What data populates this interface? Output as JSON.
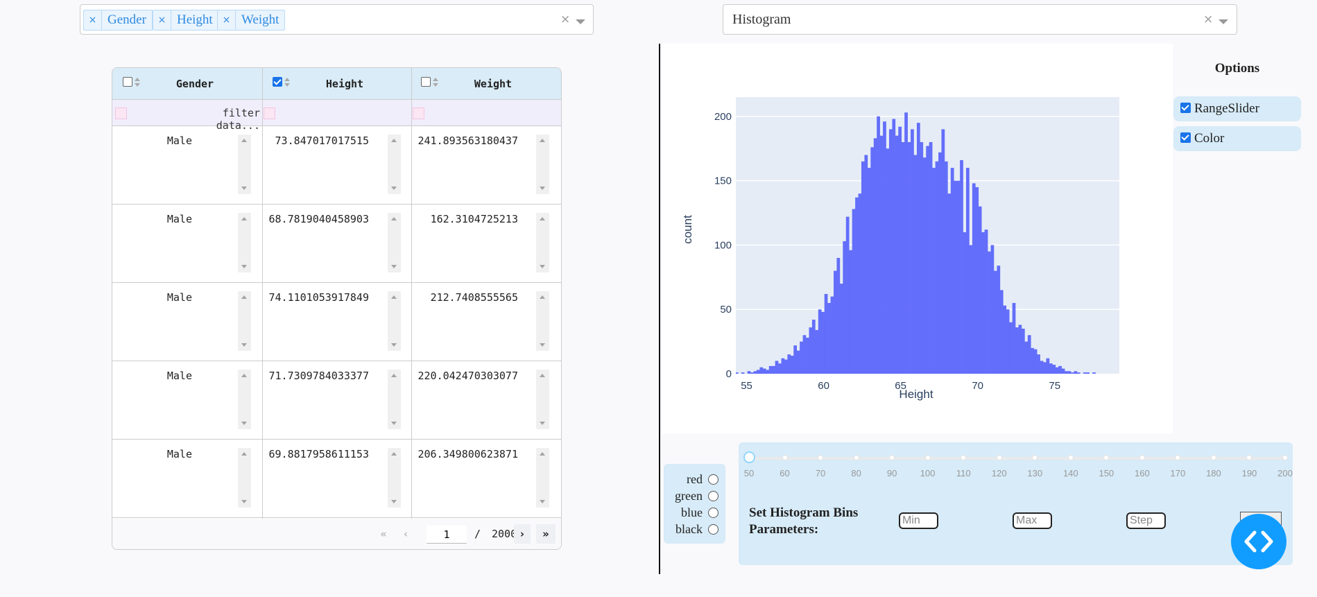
{
  "column_select": {
    "tags": [
      "Gender",
      "Height",
      "Weight"
    ],
    "clear_symbol": "×"
  },
  "chart_select": {
    "value": "Histogram",
    "clear_symbol": "×"
  },
  "table": {
    "columns": [
      {
        "label": "Gender",
        "selected": false
      },
      {
        "label": "Height",
        "selected": true
      },
      {
        "label": "Weight",
        "selected": false
      }
    ],
    "filter_placeholder": "filter data...",
    "rows": [
      [
        "Male",
        "73.847017017515",
        "241.893563180437"
      ],
      [
        "Male",
        "68.7819040458903",
        "162.3104725213"
      ],
      [
        "Male",
        "74.1101053917849",
        "212.7408555565"
      ],
      [
        "Male",
        "71.7309784033377",
        "220.042470303077"
      ],
      [
        "Male",
        "69.8817958611153",
        "206.349800623871"
      ]
    ],
    "pagination": {
      "current_page": "1",
      "separator": "/",
      "total_pages": "2000",
      "first_symbol": "«",
      "prev_symbol": "‹",
      "next_symbol": "›",
      "last_symbol": "»"
    }
  },
  "chart_data": {
    "type": "bar",
    "subtype": "histogram",
    "title": "",
    "xlabel": "Height",
    "ylabel": "count",
    "xlim": [
      54.3,
      79.2
    ],
    "ylim": [
      0,
      215
    ],
    "x_ticks": [
      55,
      60,
      65,
      70,
      75
    ],
    "y_ticks": [
      0,
      50,
      100,
      150,
      200
    ],
    "bin_start": 54.25,
    "bin_width": 0.2,
    "values": [
      1,
      0,
      1,
      0,
      2,
      1,
      2,
      3,
      5,
      4,
      3,
      6,
      6,
      10,
      8,
      12,
      11,
      15,
      14,
      22,
      18,
      25,
      30,
      28,
      36,
      42,
      34,
      50,
      48,
      62,
      55,
      60,
      80,
      90,
      70,
      103,
      122,
      96,
      128,
      137,
      140,
      165,
      170,
      160,
      176,
      183,
      200,
      185,
      196,
      175,
      190,
      198,
      185,
      192,
      180,
      203,
      180,
      190,
      170,
      195,
      180,
      168,
      177,
      180,
      160,
      165,
      172,
      190,
      165,
      140,
      160,
      150,
      150,
      166,
      110,
      160,
      100,
      148,
      145,
      130,
      110,
      112,
      95,
      100,
      80,
      84,
      65,
      53,
      50,
      40,
      55,
      36,
      38,
      35,
      25,
      30,
      20,
      19,
      15,
      10,
      9,
      12,
      8,
      7,
      5,
      6,
      4,
      2,
      2,
      1,
      2,
      1,
      0,
      1,
      1,
      0,
      1
    ]
  },
  "options": {
    "title": "Options",
    "items": [
      {
        "label": "RangeSlider",
        "checked": true
      },
      {
        "label": "Color",
        "checked": true
      }
    ]
  },
  "color_choice": {
    "options": [
      "red",
      "green",
      "blue",
      "black"
    ],
    "selected": null
  },
  "bins": {
    "label": "Set Histogram Bins Parameters:",
    "slider_marks": [
      "50",
      "60",
      "70",
      "80",
      "90",
      "100",
      "110",
      "120",
      "130",
      "140",
      "150",
      "160",
      "170",
      "180",
      "190",
      "200"
    ],
    "slider_value": 50,
    "min_placeholder": "Min",
    "max_placeholder": "Max",
    "step_placeholder": "Step"
  },
  "colors": {
    "bar": "#636efa",
    "plot_bg": "#e5ecf6",
    "panel": "#d7ebf8",
    "accent": "#119dff"
  },
  "icons": {
    "fab": "code-brackets-icon"
  }
}
